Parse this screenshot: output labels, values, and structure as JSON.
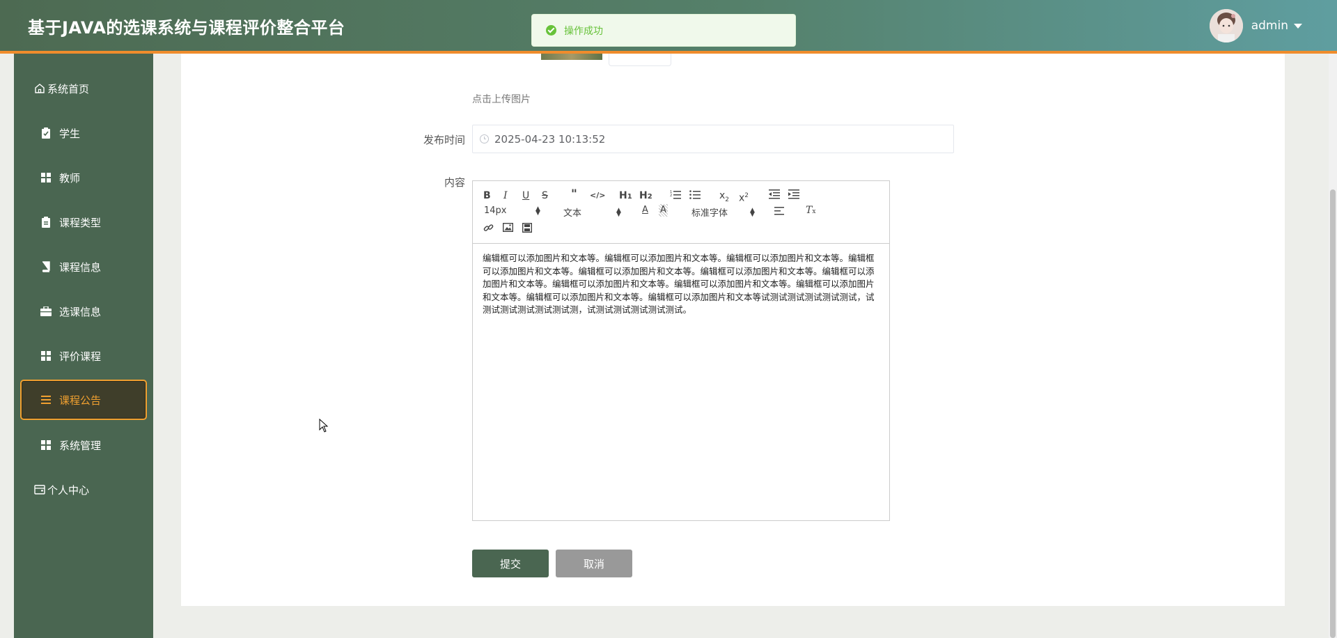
{
  "header": {
    "title": "基于JAVA的选课系统与课程评价整合平台",
    "username": "admin"
  },
  "toast": {
    "message": "操作成功"
  },
  "sidebar": {
    "items": [
      {
        "label": "系统首页",
        "icon": "home-icon"
      },
      {
        "label": "学生",
        "icon": "clipboard-icon"
      },
      {
        "label": "教师",
        "icon": "grid-icon"
      },
      {
        "label": "课程类型",
        "icon": "clipboard-icon"
      },
      {
        "label": "课程信息",
        "icon": "book-icon"
      },
      {
        "label": "选课信息",
        "icon": "briefcase-icon"
      },
      {
        "label": "评价课程",
        "icon": "grid-icon"
      },
      {
        "label": "课程公告",
        "icon": "list-icon",
        "active": true
      },
      {
        "label": "系统管理",
        "icon": "grid-icon"
      },
      {
        "label": "个人中心",
        "icon": "wallet-icon"
      }
    ]
  },
  "form": {
    "upload_hint": "点击上传图片",
    "publish_time_label": "发布时间",
    "publish_time_value": "2025-04-23 10:13:52",
    "content_label": "内容",
    "editor": {
      "font_size": "14px",
      "block_format": "文本",
      "font_family": "标准字体",
      "toolbar_icons": [
        "bold-icon",
        "italic-icon",
        "underline-icon",
        "strikethrough-icon",
        "blockquote-icon",
        "code-icon",
        "h1-icon",
        "h2-icon",
        "ordered-list-icon",
        "bullet-list-icon",
        "subscript-icon",
        "superscript-icon",
        "outdent-icon",
        "indent-icon",
        "font-color-icon",
        "background-color-icon",
        "align-icon",
        "clear-format-icon",
        "link-icon",
        "image-icon",
        "video-icon"
      ],
      "content": "编辑框可以添加图片和文本等。编辑框可以添加图片和文本等。编辑框可以添加图片和文本等。编辑框可以添加图片和文本等。编辑框可以添加图片和文本等。编辑框可以添加图片和文本等。编辑框可以添加图片和文本等。编辑框可以添加图片和文本等。编辑框可以添加图片和文本等。编辑框可以添加图片和文本等。编辑框可以添加图片和文本等。编辑框可以添加图片和文本等试测试测试测试测试测试，试测试测试测试测试测试测，试测试测试测试测试测试。"
    },
    "submit_label": "提交",
    "cancel_label": "取消"
  },
  "colors": {
    "sidebar_bg": "#4a6651",
    "accent_orange": "#f08c2c",
    "active_border": "#f0a030",
    "success_green": "#67c23a"
  }
}
